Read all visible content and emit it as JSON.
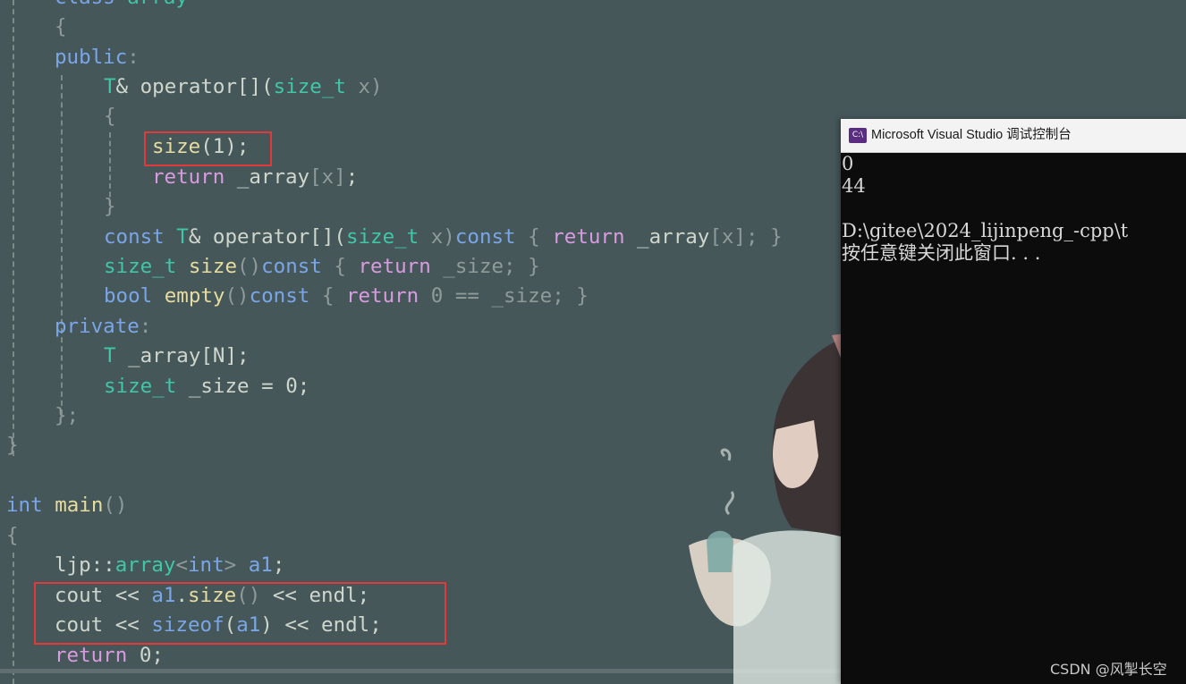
{
  "editor": {
    "lines": [
      [
        {
          "t": "class",
          "c": "k"
        },
        {
          "t": " "
        },
        {
          "t": "array",
          "c": "t"
        }
      ],
      [
        {
          "t": "{",
          "c": "p"
        }
      ],
      [
        {
          "t": "public",
          "c": "k"
        },
        {
          "t": ":",
          "c": "p"
        }
      ],
      [
        {
          "t": "T",
          "c": "t"
        },
        {
          "t": "& operator[](",
          "c": "n"
        },
        {
          "t": "size_t",
          "c": "t"
        },
        {
          "t": " x)",
          "c": "p"
        }
      ],
      [
        {
          "t": "{",
          "c": "p"
        }
      ],
      [
        {
          "t": "size",
          "c": "f"
        },
        {
          "t": "(1);",
          "c": "n"
        }
      ],
      [
        {
          "t": "return",
          "c": "r"
        },
        {
          "t": " _array",
          "c": "n"
        },
        {
          "t": "[x]",
          "c": "p"
        },
        {
          "t": ";",
          "c": "n"
        }
      ],
      [
        {
          "t": "}",
          "c": "p"
        }
      ],
      [
        {
          "t": "const",
          "c": "k"
        },
        {
          "t": " "
        },
        {
          "t": "T",
          "c": "t"
        },
        {
          "t": "& operator[](",
          "c": "n"
        },
        {
          "t": "size_t",
          "c": "t"
        },
        {
          "t": " x)",
          "c": "p"
        },
        {
          "t": "const",
          "c": "k"
        },
        {
          "t": " { ",
          "c": "p"
        },
        {
          "t": "return",
          "c": "r"
        },
        {
          "t": " _array",
          "c": "n"
        },
        {
          "t": "[x]",
          "c": "p"
        },
        {
          "t": "; }",
          "c": "p"
        }
      ],
      [
        {
          "t": "size_t",
          "c": "t"
        },
        {
          "t": " "
        },
        {
          "t": "size",
          "c": "f"
        },
        {
          "t": "()",
          "c": "p"
        },
        {
          "t": "const",
          "c": "k"
        },
        {
          "t": " { ",
          "c": "p"
        },
        {
          "t": "return",
          "c": "r"
        },
        {
          "t": " _size; }",
          "c": "p"
        }
      ],
      [
        {
          "t": "bool",
          "c": "k"
        },
        {
          "t": " "
        },
        {
          "t": "empty",
          "c": "f"
        },
        {
          "t": "()",
          "c": "p"
        },
        {
          "t": "const",
          "c": "k"
        },
        {
          "t": " { ",
          "c": "p"
        },
        {
          "t": "return",
          "c": "r"
        },
        {
          "t": " 0 == _size; }",
          "c": "p"
        }
      ],
      [
        {
          "t": "private",
          "c": "k"
        },
        {
          "t": ":",
          "c": "p"
        }
      ],
      [
        {
          "t": "T",
          "c": "t"
        },
        {
          "t": " _array[N];",
          "c": "n"
        }
      ],
      [
        {
          "t": "size_t",
          "c": "t"
        },
        {
          "t": " _size = 0;",
          "c": "n"
        }
      ],
      [
        {
          "t": "};",
          "c": "p"
        }
      ],
      [
        {
          "t": "}",
          "c": "p"
        }
      ],
      [],
      [
        {
          "t": "int",
          "c": "k"
        },
        {
          "t": " "
        },
        {
          "t": "main",
          "c": "f"
        },
        {
          "t": "()",
          "c": "p"
        }
      ],
      [
        {
          "t": "{",
          "c": "p"
        }
      ],
      [
        {
          "t": "ljp::",
          "c": "n"
        },
        {
          "t": "array",
          "c": "t"
        },
        {
          "t": "<",
          "c": "p"
        },
        {
          "t": "int",
          "c": "k"
        },
        {
          "t": "> ",
          "c": "p"
        },
        {
          "t": "a1",
          "c": "k"
        },
        {
          "t": ";",
          "c": "n"
        }
      ],
      [
        {
          "t": "cout << ",
          "c": "n"
        },
        {
          "t": "a1",
          "c": "k"
        },
        {
          "t": ".",
          "c": "n"
        },
        {
          "t": "size",
          "c": "f"
        },
        {
          "t": "()",
          "c": "p"
        },
        {
          "t": " << endl;",
          "c": "n"
        }
      ],
      [
        {
          "t": "cout << ",
          "c": "n"
        },
        {
          "t": "sizeof",
          "c": "k"
        },
        {
          "t": "(",
          "c": "n"
        },
        {
          "t": "a1",
          "c": "k"
        },
        {
          "t": ") << endl;",
          "c": "n"
        }
      ],
      [
        {
          "t": "return",
          "c": "r"
        },
        {
          "t": " 0;",
          "c": "n"
        }
      ]
    ]
  },
  "console": {
    "title": "Microsoft Visual Studio 调试控制台",
    "icon_label": "C:\\",
    "output": [
      "0",
      "44",
      "",
      "D:\\gitee\\2024_lijinpeng_-cpp\\t",
      "按任意键关闭此窗口. . ."
    ]
  },
  "watermark": "CSDN @风掣长空",
  "colors": {
    "editor_bg": "#46575a",
    "keyword": "#7aa6e8",
    "type": "#3fc7a6",
    "function": "#e6dca0",
    "return": "#d99be0",
    "highlight_box": "#e23a3a",
    "console_bg": "#0c0c0c"
  }
}
